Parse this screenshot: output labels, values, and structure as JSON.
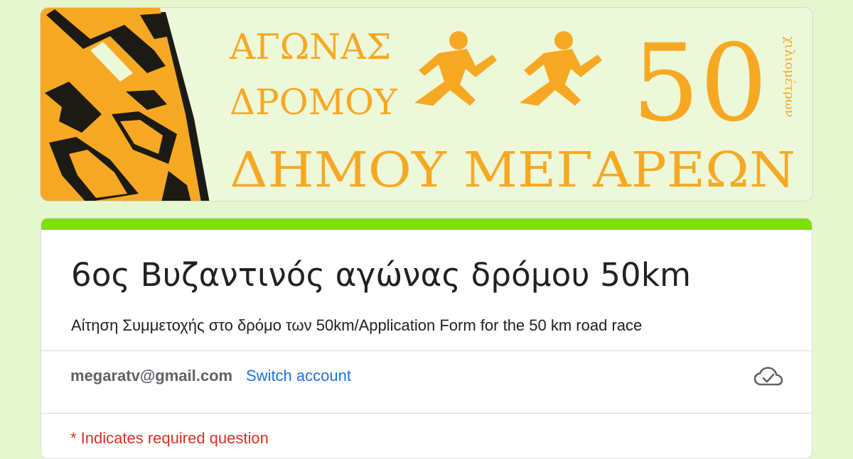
{
  "banner": {
    "line1": "ΑΓΩΝΑΣ",
    "line2": "ΔΡΟΜΟΥ",
    "line3": "ΔΗΜΟΥ ΜΕΓΑΡΕΩΝ",
    "distance_number": "50",
    "distance_unit": "χιλιομέτρων",
    "colors": {
      "orange": "#f7a823",
      "background": "#ecf8d8",
      "shadow": "#1c1a14"
    }
  },
  "form": {
    "accent_color": "#80e000",
    "title": "6ος Βυζαντινός αγώνας δρόμου 50km",
    "description": "Αίτηση Συμμετοχής στο δρόμο των 50km/Application Form for the 50 km road race",
    "account_email": "megaratv@gmail.com",
    "switch_account_label": "Switch account",
    "cloud_status_icon": "cloud-saved-icon",
    "required_note": "* Indicates required question"
  }
}
